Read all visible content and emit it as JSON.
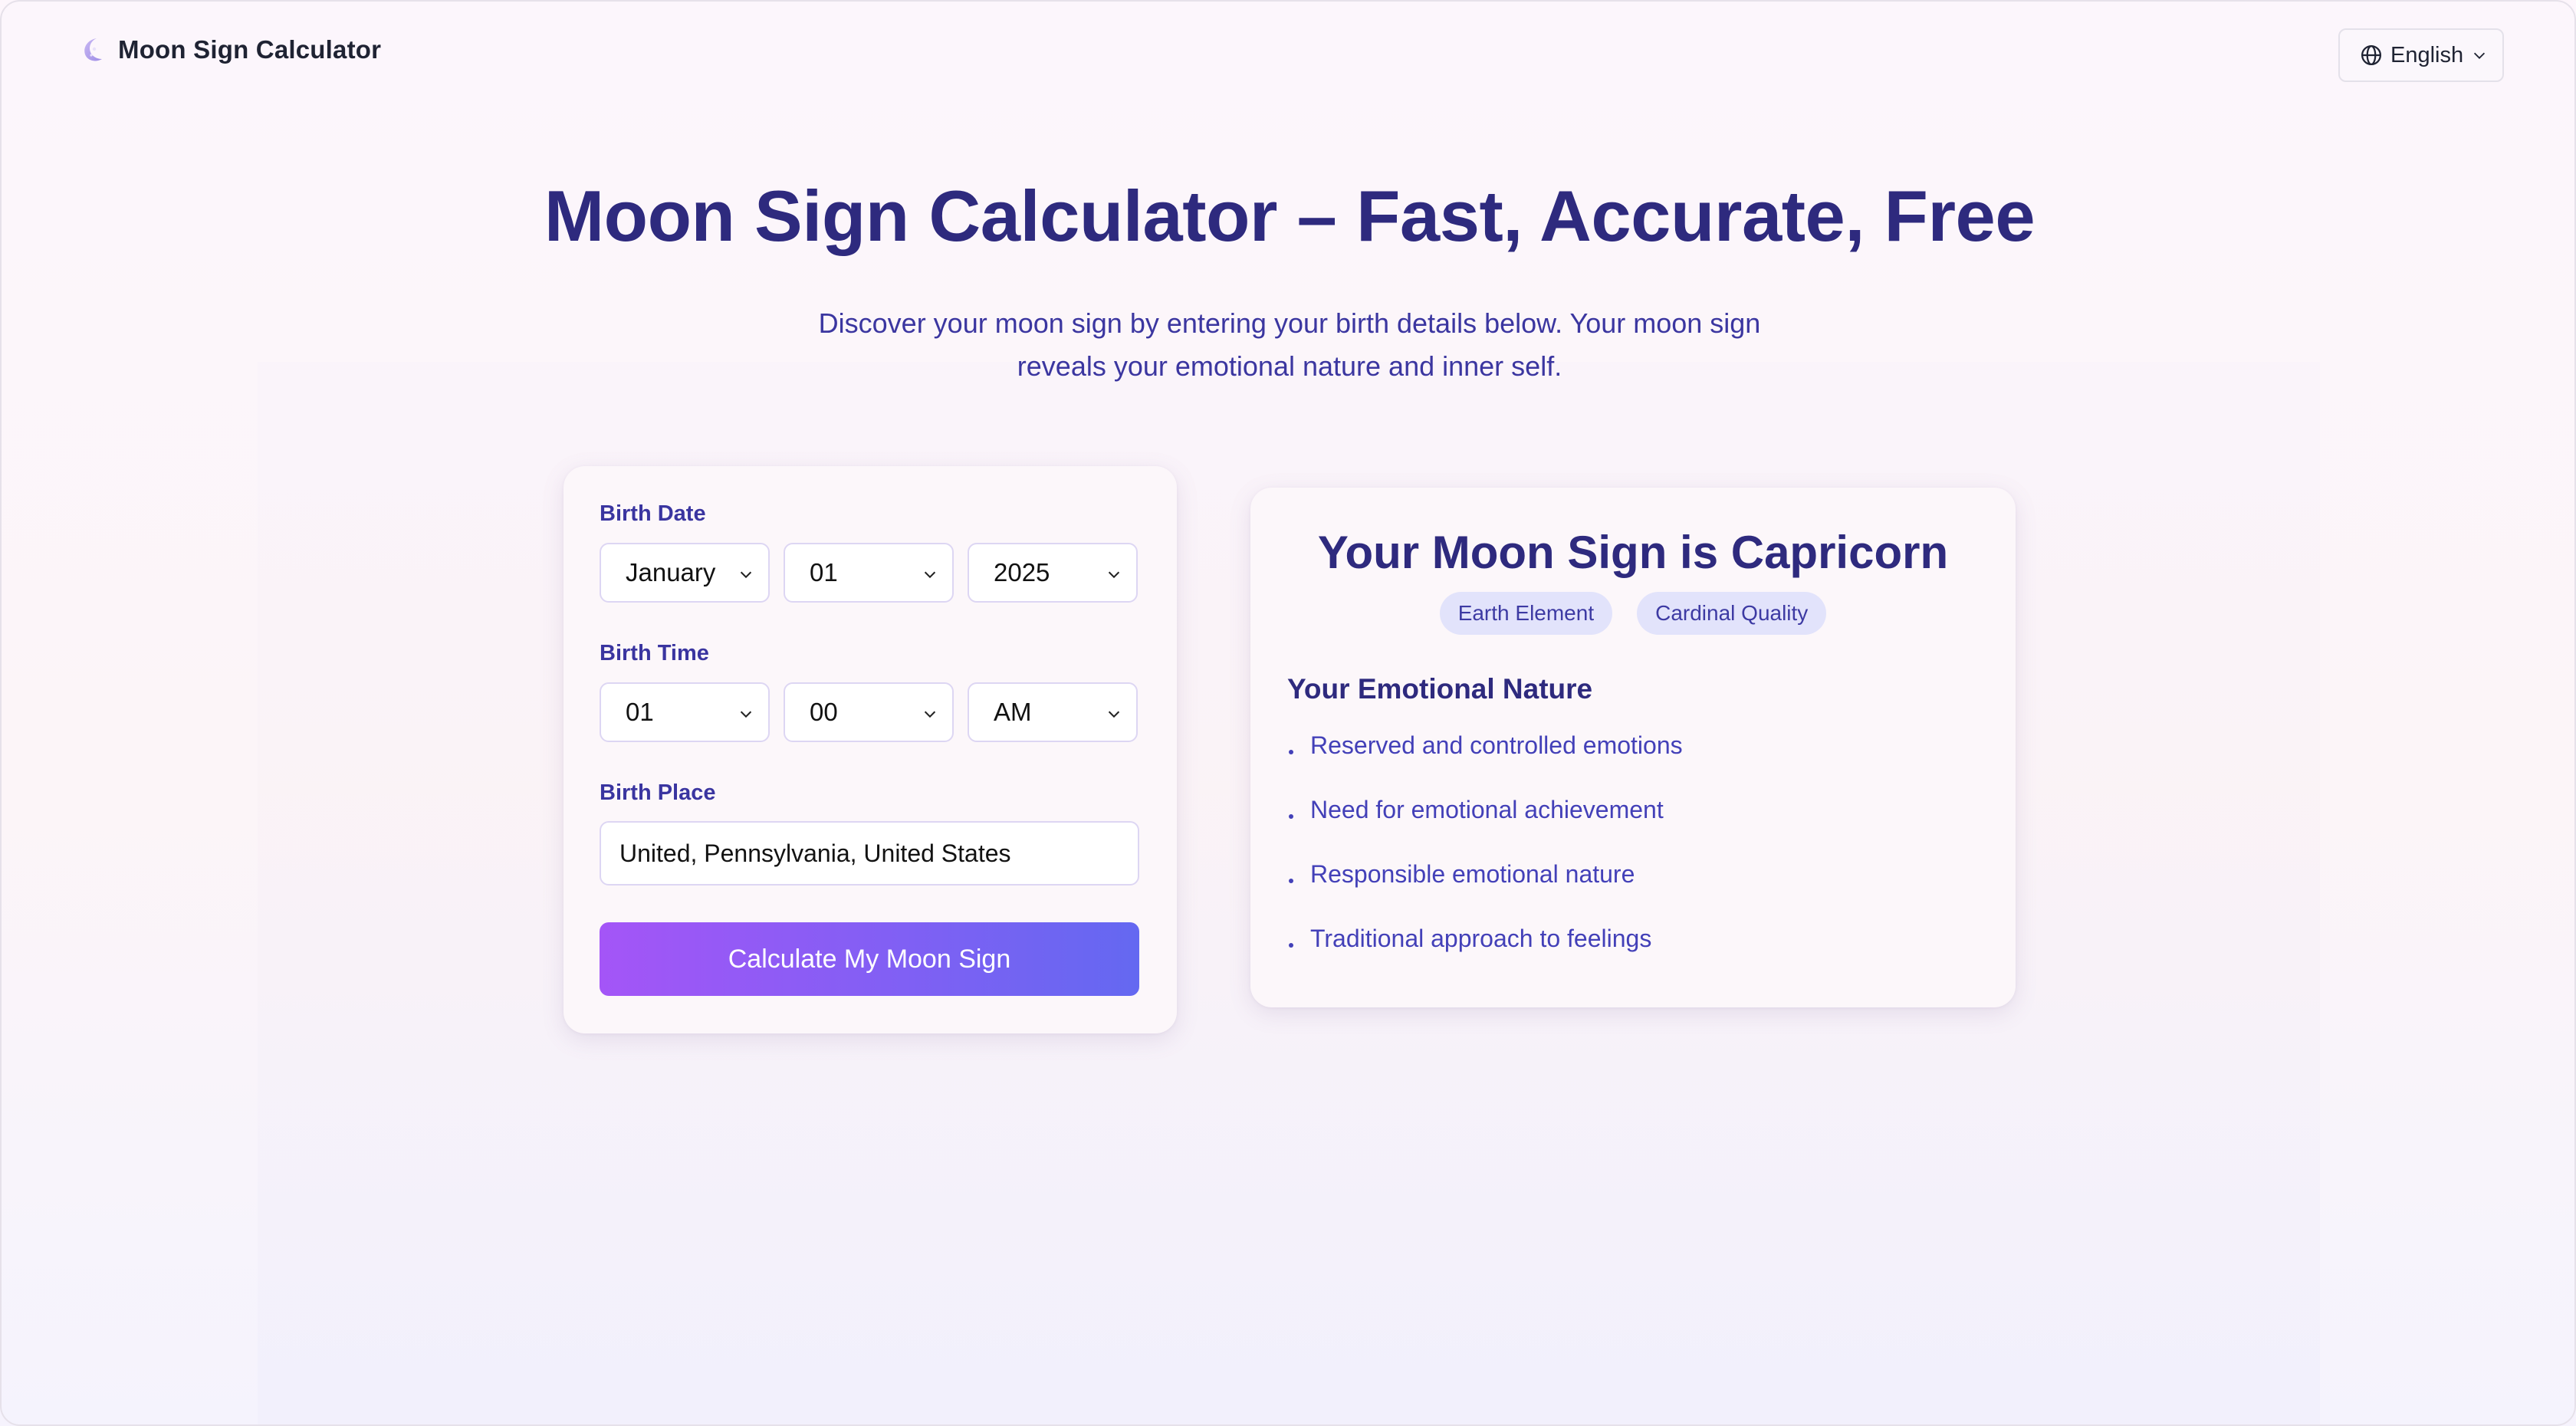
{
  "header": {
    "brand_name": "Moon Sign Calculator",
    "brand_icon": "moon-icon",
    "language": {
      "label": "English",
      "icon": "globe-icon"
    }
  },
  "hero": {
    "title": "Moon Sign Calculator – Fast, Accurate, Free",
    "subtitle_line1": "Discover your moon sign by entering your birth details below. Your moon sign",
    "subtitle_line2": "reveals your emotional nature and inner self."
  },
  "form": {
    "birth_date": {
      "label": "Birth Date",
      "month": "January",
      "day": "01",
      "year": "2025"
    },
    "birth_time": {
      "label": "Birth Time",
      "hour": "01",
      "minute": "00",
      "period": "AM"
    },
    "birth_place": {
      "label": "Birth Place",
      "value": "United, Pennsylvania, United States"
    },
    "submit_label": "Calculate My Moon Sign"
  },
  "result": {
    "title": "Your Moon Sign is Capricorn",
    "badges": [
      "Earth Element",
      "Cardinal Quality"
    ],
    "section_heading": "Your Emotional Nature",
    "traits": [
      "Reserved and controlled emotions",
      "Need for emotional achievement",
      "Responsible emotional nature",
      "Traditional approach to feelings"
    ]
  },
  "colors": {
    "primary_text": "#2e2a7e",
    "accent_gradient_start": "#a455f7",
    "accent_gradient_end": "#6468f1",
    "badge_bg": "#e2e3fb"
  }
}
